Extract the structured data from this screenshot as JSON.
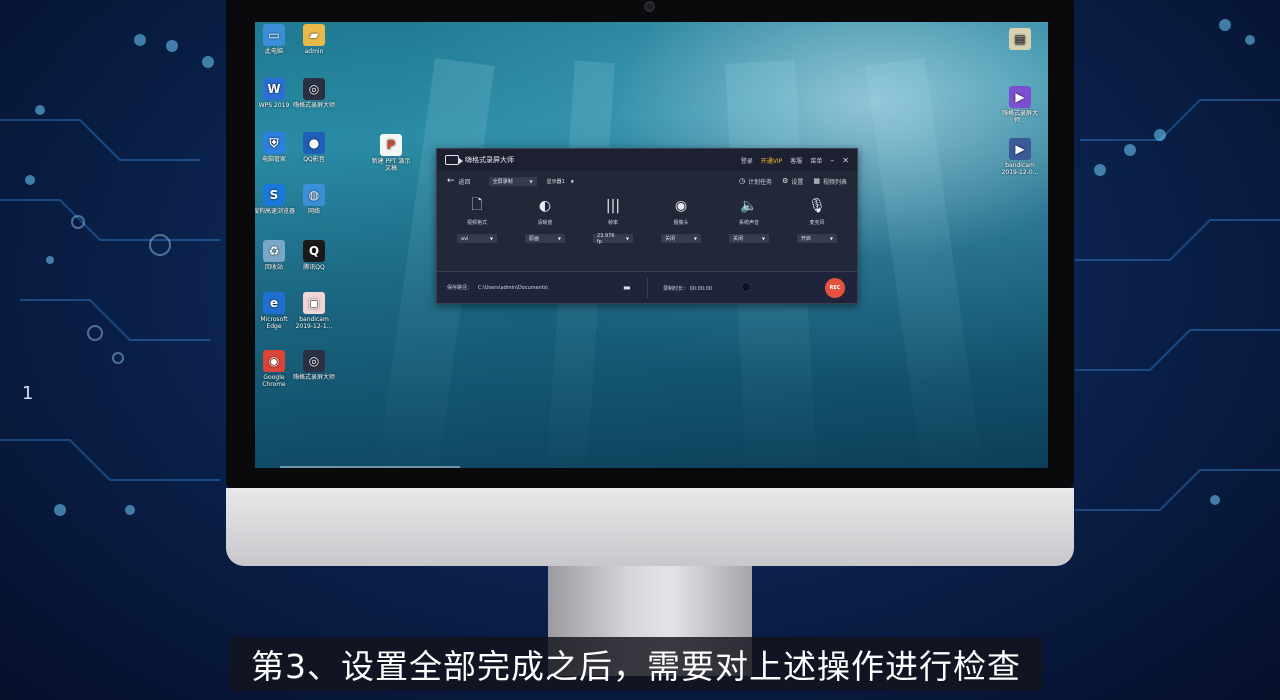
{
  "background": {
    "digit": "1"
  },
  "desktop": {
    "icons_left": [
      {
        "label": "此电脑",
        "icon": "computer-icon",
        "color": "#3a8fd8"
      },
      {
        "label": "admin",
        "icon": "folder-icon",
        "color": "#e9b949"
      },
      {
        "label": "WPS 2019",
        "icon": "wps-icon",
        "color": "#2a6fd6"
      },
      {
        "label": "嗨格式录屏大师",
        "icon": "screen-recorder-icon",
        "color": "#2b3142"
      },
      {
        "label": "电脑管家",
        "icon": "shield-icon",
        "color": "#2d7fe0"
      },
      {
        "label": "QQ影音",
        "icon": "qq-player-icon",
        "color": "#1f5fb8"
      },
      {
        "label": "搜狗高速浏览器",
        "icon": "sogou-browser-icon",
        "color": "#1a78d8"
      },
      {
        "label": "网络",
        "icon": "network-icon",
        "color": "#3a8fd8"
      },
      {
        "label": "回收站",
        "icon": "recycle-bin-icon",
        "color": "#7aa7c8"
      },
      {
        "label": "腾讯QQ",
        "icon": "qq-icon",
        "color": "#1a1a1a"
      },
      {
        "label": "Microsoft Edge",
        "icon": "edge-icon",
        "color": "#1e6fd0"
      },
      {
        "label": "bandicam 2019-12-1...",
        "icon": "image-file-icon",
        "color": "#f2d5d5"
      },
      {
        "label": "Google Chrome",
        "icon": "chrome-icon",
        "color": "#db4437"
      },
      {
        "label": "嗨格式录屏大师",
        "icon": "screen-recorder-icon",
        "color": "#2b3142"
      }
    ],
    "icon_ppt": {
      "label": "新建 PPT 演示文稿",
      "icon": "ppt-file-icon",
      "color": "#f5f5f5"
    },
    "icons_right": [
      {
        "label": "",
        "icon": "doc-file-icon",
        "color": "#d8d0b0"
      },
      {
        "label": "嗨格式录屏大师...",
        "icon": "video-file-icon",
        "color": "#7a4fd0"
      },
      {
        "label": "bandicam 2019-12-0...",
        "icon": "video-file-icon",
        "color": "#3a5a98"
      }
    ]
  },
  "app": {
    "title": "嗨格式录屏大师",
    "menu": {
      "login": "登录",
      "vip": "开通VIP",
      "service": "客服",
      "menu": "菜单"
    },
    "toolbar": {
      "back": "返回",
      "mode": "全屏录制",
      "display": "显示器1",
      "schedule": "计划任务",
      "settings": "设置",
      "video_list": "视频列表"
    },
    "controls": [
      {
        "label": "视频格式",
        "value": "avi",
        "icon": "file-icon"
      },
      {
        "label": "清晰度",
        "value": "原画",
        "icon": "contrast-icon"
      },
      {
        "label": "帧率",
        "value": "23.976 fp",
        "icon": "waveform-icon"
      },
      {
        "label": "摄像头",
        "value": "关闭",
        "icon": "webcam-icon"
      },
      {
        "label": "系统声音",
        "value": "关闭",
        "icon": "speaker-icon"
      },
      {
        "label": "麦克风",
        "value": "开启",
        "icon": "microphone-icon"
      }
    ],
    "bottom": {
      "save_path_label": "保存路径：",
      "save_path": "C:\\Users\\admin\\Documents\\",
      "duration_label": "录制时长：",
      "duration": "00:00:00",
      "rec": "REC"
    }
  },
  "subtitle": "第3、设置全部完成之后，需要对上述操作进行检查"
}
